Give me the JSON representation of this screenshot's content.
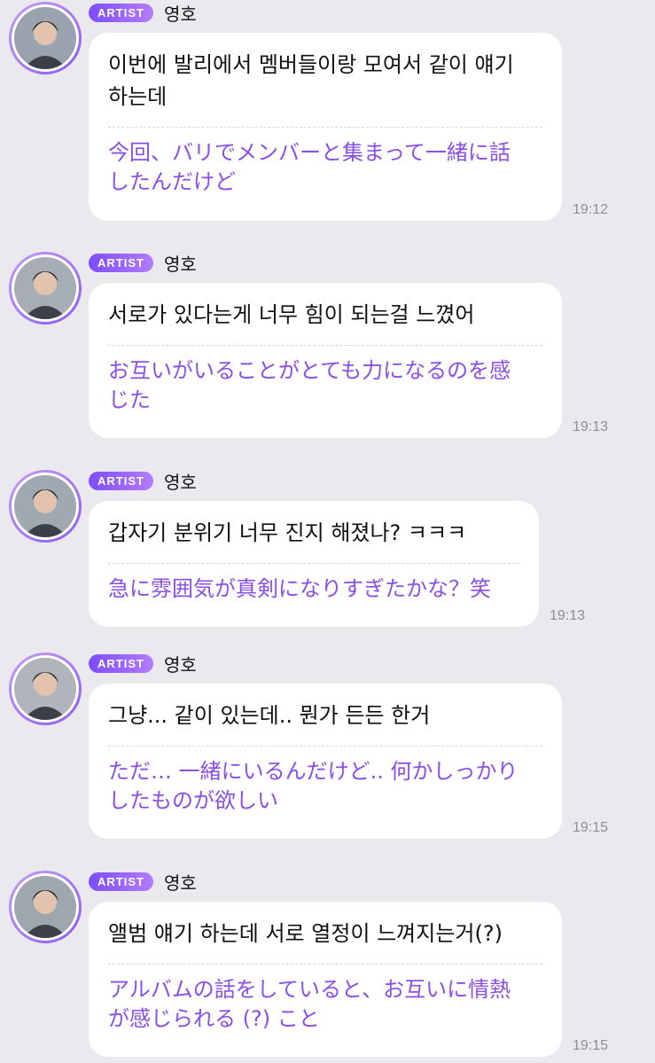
{
  "messages": [
    {
      "badge": "ARTIST",
      "name": "영호",
      "ko": "이번에 발리에서 멤버들이랑 모여서 같이 얘기\n하는데",
      "ja": "今回、バリでメンバーと集まって一緒に話\nしたんだけど",
      "time": "19:12"
    },
    {
      "badge": "ARTIST",
      "name": "영호",
      "ko": "서로가 있다는게 너무 힘이 되는걸 느꼈어",
      "ja": "お互いがいることがとても力になるのを感\nじた",
      "time": "19:13"
    },
    {
      "badge": "ARTIST",
      "name": "영호",
      "ko": "갑자기 분위기 너무 진지 해졌나? ㅋㅋㅋ",
      "ja": "急に雰囲気が真剣になりすぎたかな？笑",
      "time": "19:13"
    },
    {
      "badge": "ARTIST",
      "name": "영호",
      "ko": "그냥... 같이 있는데.. 뭔가 든든 한거",
      "ja": "ただ… 一緒にいるんだけど.. 何かしっかり\nしたものが欲しい",
      "time": "19:15"
    },
    {
      "badge": "ARTIST",
      "name": "영호",
      "ko": "앨범 얘기 하는데 서로 열정이 느껴지는거(?)",
      "ja": "アルバムの話をしていると、お互いに情熱\nが感じられる (?) こと",
      "time": "19:15"
    }
  ]
}
